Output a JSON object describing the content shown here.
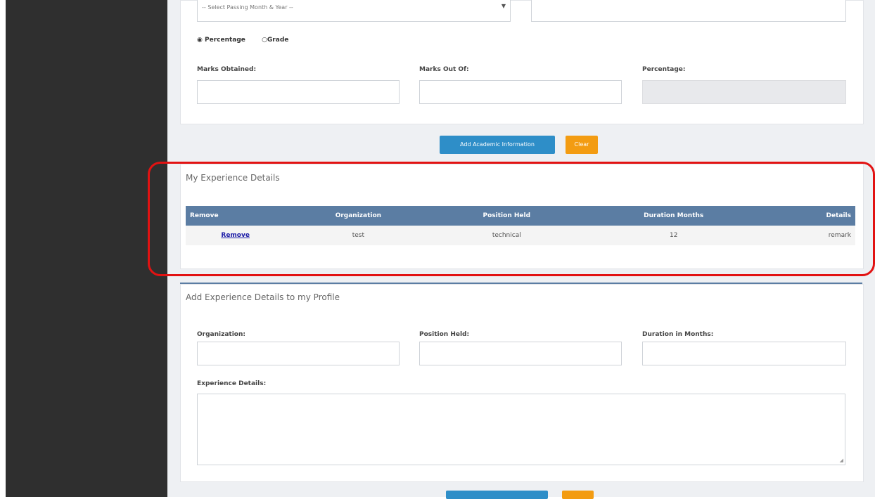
{
  "education": {
    "passing_select": "-- Select Passing Month & Year --",
    "radio_percentage": "Percentage",
    "radio_grade": "Grade",
    "marks_obtained_label": "Marks Obtained:",
    "marks_out_of_label": "Marks Out Of:",
    "percentage_label": "Percentage:",
    "add_button": "Add Academic Information",
    "clear_button": "Clear"
  },
  "experience": {
    "title": "My Experience Details",
    "columns": [
      "Remove",
      "Organization",
      "Position Held",
      "Duration Months",
      "Details"
    ],
    "rows": [
      {
        "remove": "Remove",
        "organization": "test",
        "position": "technical",
        "duration": "12",
        "details": "remark"
      }
    ]
  },
  "add_experience": {
    "title": "Add Experience Details to my Profile",
    "organization_label": "Organization:",
    "position_label": "Position Held:",
    "duration_label": "Duration in Months:",
    "details_label": "Experience Details:"
  },
  "colors": {
    "sidebar": "#2f2f2f",
    "table_header": "#5b7da3",
    "button_blue": "#2e8ec8",
    "button_orange": "#f39c12",
    "highlight": "#e21212"
  }
}
